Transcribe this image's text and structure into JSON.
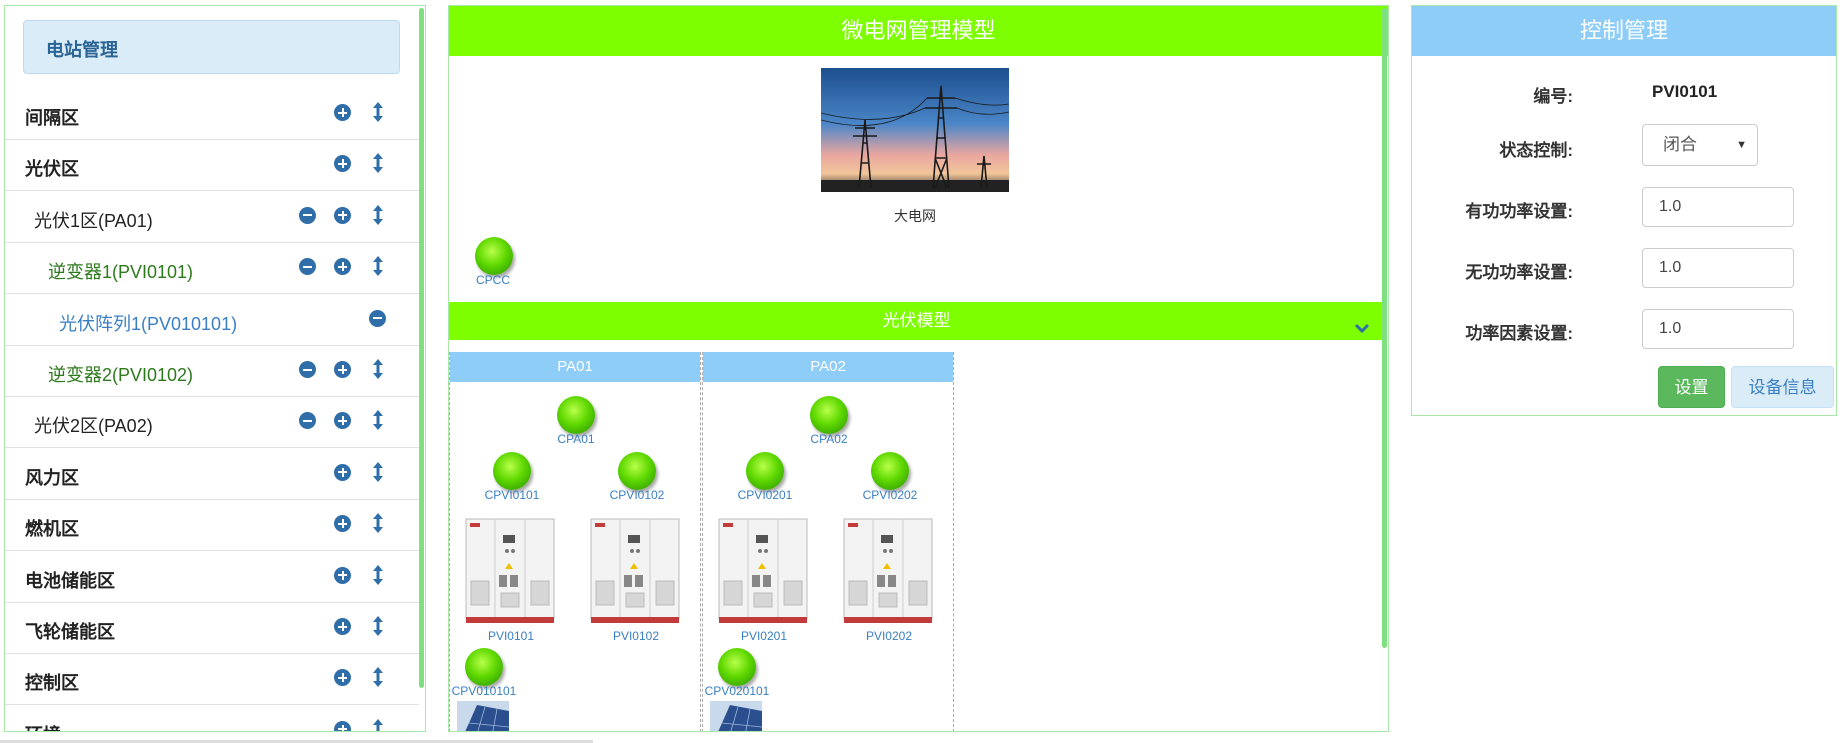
{
  "left": {
    "title": "电站管理",
    "tree": [
      {
        "label": "间隔区",
        "level": 0,
        "minus": false
      },
      {
        "label": "光伏区",
        "level": 0,
        "minus": false
      },
      {
        "label": "光伏1区(PA01)",
        "level": 1,
        "minus": true
      },
      {
        "label": "逆变器1(PVI0101)",
        "level": 2,
        "minus": true
      },
      {
        "label": "光伏阵列1(PV010101)",
        "level": 3,
        "minus": true
      },
      {
        "label": "逆变器2(PVI0102)",
        "level": 2,
        "minus": true
      },
      {
        "label": "光伏2区(PA02)",
        "level": 1,
        "minus": true
      },
      {
        "label": "风力区",
        "level": 0,
        "minus": false
      },
      {
        "label": "燃机区",
        "level": 0,
        "minus": false
      },
      {
        "label": "电池储能区",
        "level": 0,
        "minus": false
      },
      {
        "label": "飞轮储能区",
        "level": 0,
        "minus": false
      },
      {
        "label": "控制区",
        "level": 0,
        "minus": false
      },
      {
        "label": "环境",
        "level": 0,
        "minus": false
      }
    ],
    "icons": {
      "plus": "plus-circle-icon",
      "minus": "minus-circle-icon",
      "move": "move-vertical-icon"
    }
  },
  "middle": {
    "title": "微电网管理模型",
    "grid_label": "大电网",
    "pcc_label": "CPCC",
    "pv_section_title": "光伏模型",
    "areas": [
      {
        "name": "PA01",
        "area_breaker": "CPA01",
        "inverters": [
          {
            "breaker": "CPVI0101",
            "name": "PVI0101"
          },
          {
            "breaker": "CPVI0102",
            "name": "PVI0102"
          }
        ],
        "array_breaker": "CPV010101"
      },
      {
        "name": "PA02",
        "area_breaker": "CPA02",
        "inverters": [
          {
            "breaker": "CPVI0201",
            "name": "PVI0201"
          },
          {
            "breaker": "CPVI0202",
            "name": "PVI0202"
          }
        ],
        "array_breaker": "CPV020101"
      }
    ]
  },
  "right": {
    "title": "控制管理",
    "id_label": "编号:",
    "id_value": "PVI0101",
    "state_label": "状态控制:",
    "state_value": "闭合",
    "p_label": "有功功率设置:",
    "p_value": "1.0",
    "q_label": "无功功率设置:",
    "q_value": "1.0",
    "pf_label": "功率因素设置:",
    "pf_value": "1.0",
    "set_button": "设置",
    "info_button": "设备信息"
  },
  "colors": {
    "accent_green": "#7dff00",
    "accent_blue": "#8ecdf8",
    "button_green": "#5cb85c"
  }
}
